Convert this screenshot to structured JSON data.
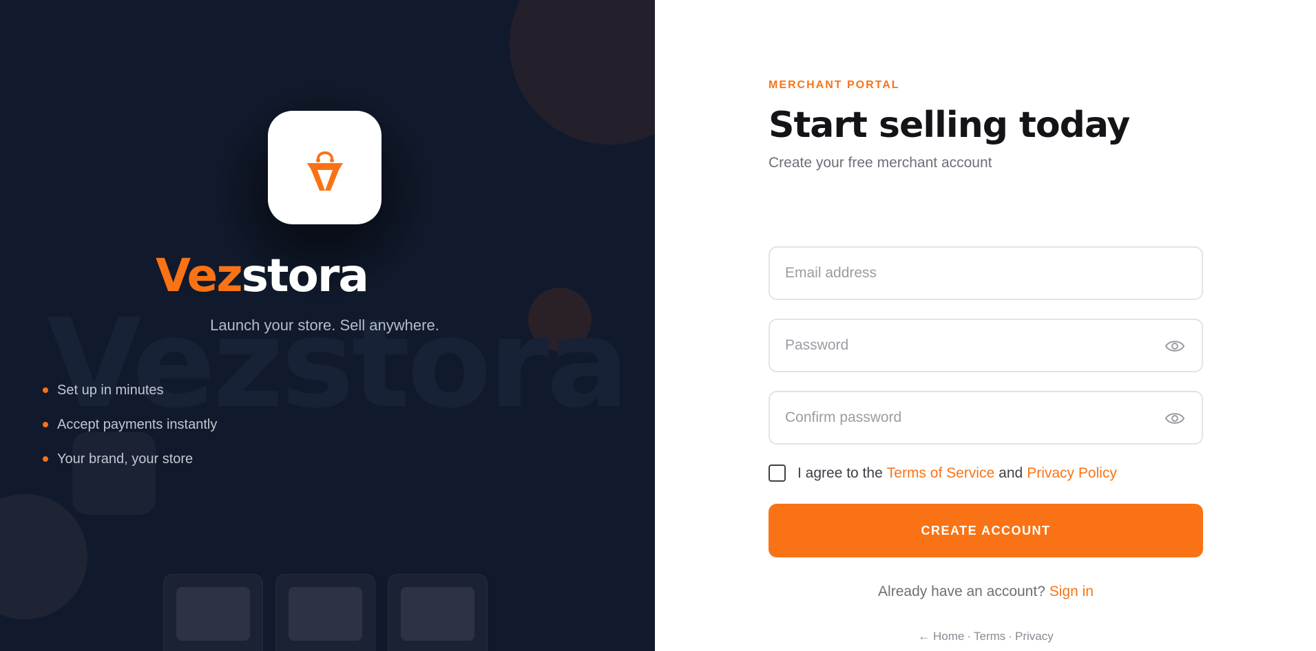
{
  "brand": {
    "name_part1": "Vez",
    "name_part2": "stora",
    "watermark": "Vezstora",
    "tagline": "Launch your store. Sell anywhere.",
    "accent_color": "#f97316",
    "logo_icon": "shopping-bag-icon"
  },
  "features": [
    {
      "label": "Set up in minutes"
    },
    {
      "label": "Accept payments instantly"
    },
    {
      "label": "Your brand, your store"
    }
  ],
  "form": {
    "eyebrow": "MERCHANT PORTAL",
    "title": "Start selling today",
    "subtitle": "Create your free merchant account",
    "email_placeholder": "Email address",
    "password_placeholder": "Password",
    "confirm_placeholder": "Confirm password",
    "agree_prefix": "I agree to the",
    "terms_link": "Terms of Service",
    "agree_and": "and",
    "privacy_link": "Privacy Policy",
    "submit_label": "CREATE ACCOUNT",
    "have_account": "Already have an account?",
    "sign_in_link": "Sign in"
  },
  "footer": {
    "home": "← Home",
    "sep": "·",
    "terms": "Terms",
    "privacy": "Privacy"
  }
}
